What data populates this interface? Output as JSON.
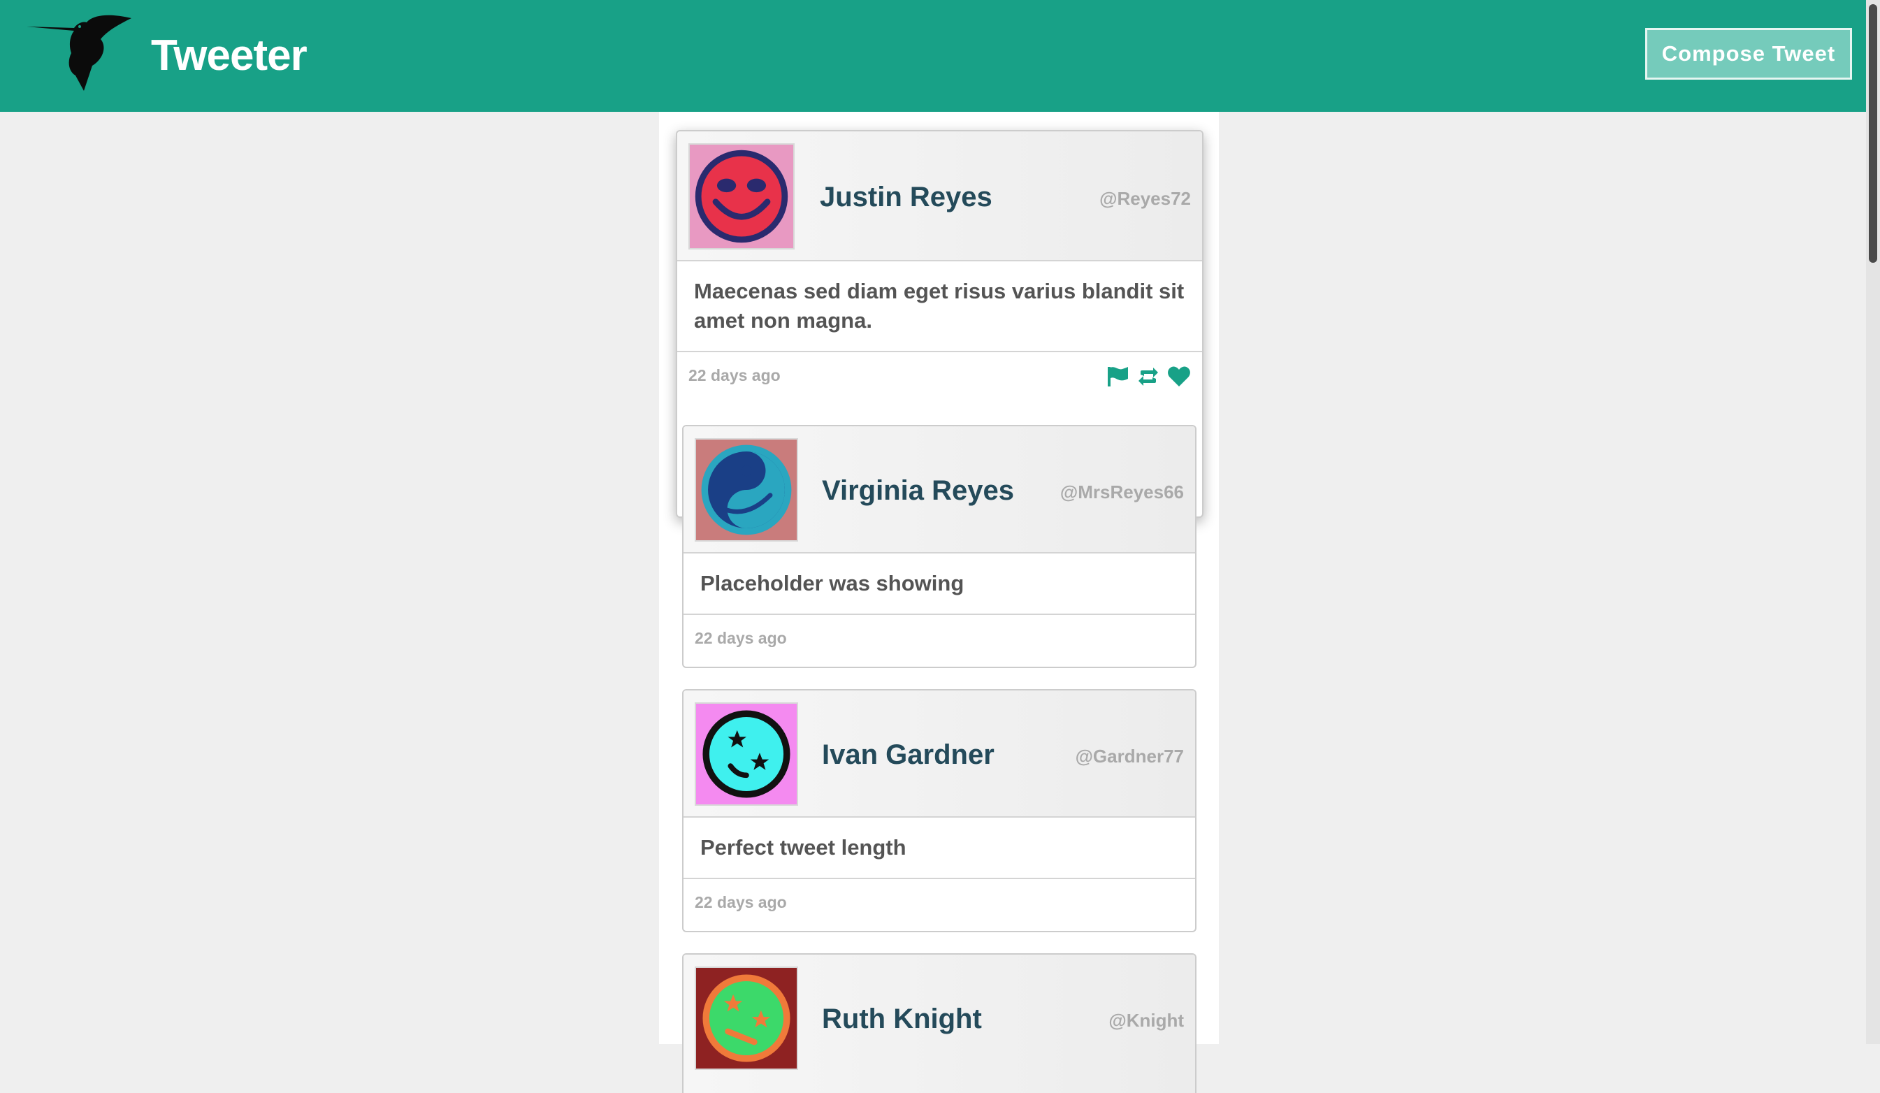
{
  "header": {
    "logo_icon": "hummingbird-icon",
    "brand": "Tweeter",
    "compose_label": "Compose Tweet",
    "accent_color": "#18a187"
  },
  "tweets": [
    {
      "name": "Justin Reyes",
      "handle": "@Reyes72",
      "text": "Maecenas sed diam eget risus varius blandit sit amet non magna.",
      "time": "22 days ago",
      "avatar_icon": "smiley-face-avatar-icon",
      "avatar_bg": "#e899c2",
      "actions": [
        "flag-icon",
        "retweet-icon",
        "heart-icon"
      ]
    },
    {
      "name": "Virginia Reyes",
      "handle": "@MrsReyes66",
      "text": "Placeholder was showing",
      "time": "22 days ago",
      "avatar_icon": "yin-yang-face-avatar-icon",
      "avatar_bg": "#c97c7c"
    },
    {
      "name": "Ivan Gardner",
      "handle": "@Gardner77",
      "text": "Perfect tweet length",
      "time": "22 days ago",
      "avatar_icon": "star-eyes-face-avatar-icon",
      "avatar_bg": "#f48af0"
    },
    {
      "name": "Ruth Knight",
      "handle": "@Knight",
      "avatar_icon": "star-eyes-face-avatar-icon",
      "avatar_bg": "#8e2222"
    }
  ]
}
